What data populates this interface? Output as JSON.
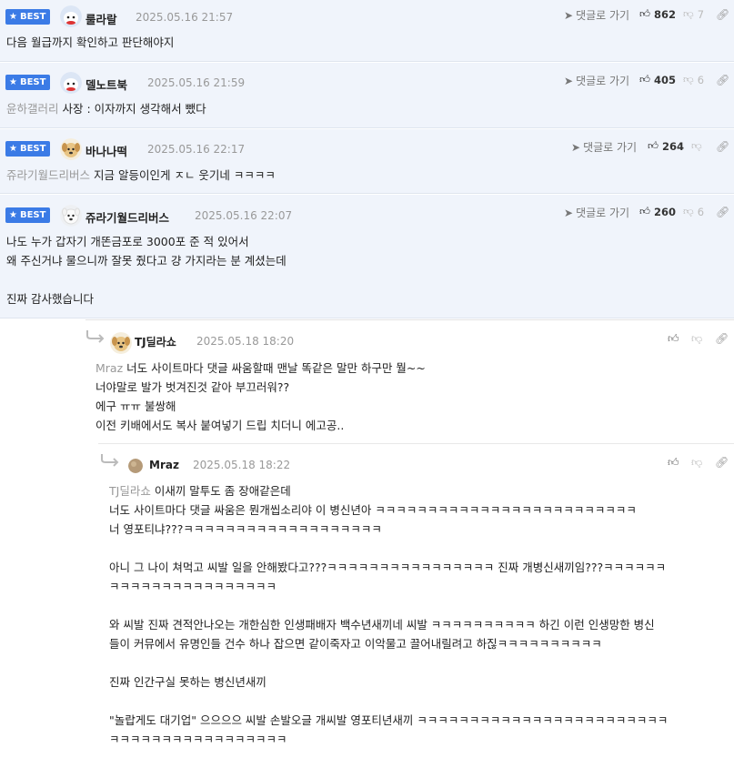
{
  "best_label": "BEST",
  "goto_label": "댓글로 가기",
  "comments": [
    {
      "nick": "룰라랄",
      "date": "2025.05.16 21:57",
      "up": "862",
      "down": "7",
      "lines": [
        "다음 월급까지 확인하고 판단해야지"
      ],
      "avatar": "rabbit-avatar"
    },
    {
      "nick": "델노트북",
      "date": "2025.05.16 21:59",
      "up": "405",
      "down": "6",
      "mention": "윤하갤러리",
      "lines": [
        "사장 : 이자까지 생각해서 뺐다"
      ],
      "avatar": "rabbit-avatar"
    },
    {
      "nick": "바나나떡",
      "date": "2025.05.16 22:17",
      "up": "264",
      "down": "",
      "mention": "쥬라기월드리버스",
      "lines": [
        "지금 알등이인게 ㅈㄴ 웃기네 ㅋㅋㅋㅋ"
      ],
      "avatar": "dog-avatar"
    },
    {
      "nick": "쥬라기월드리버스",
      "date": "2025.05.16 22:07",
      "up": "260",
      "down": "6",
      "lines": [
        "나도 누가 갑자기 개똔금포로 3000포 준 적 있어서",
        "왜 주신거냐 물으니까 잘못 줬다고 걍 가지라는 분 계셨는데",
        "",
        "진짜 감사했습니다"
      ],
      "avatar": "dog-white-avatar"
    }
  ],
  "reply1": {
    "nick": "TJ딜라쇼",
    "date": "2025.05.18 18:20",
    "mention": "Mraz",
    "lines": [
      "너도 사이트마다 댓글 싸움할때 맨날 똑같은 말만 하구만 뭘~~",
      "너야말로 발가 벗겨진것 같아 부끄러워??",
      "에구 ㅠㅠ 불쌍해",
      "이전 키배에서도 복사 붙여넣기 드립 치더니 에고공.."
    ]
  },
  "reply2": {
    "nick": "Mraz",
    "date": "2025.05.18 18:22",
    "mention": "TJ딜라쇼",
    "lines": [
      "이새끼 말투도 좀 장애같은데",
      "너도 사이트마다 댓글 싸움은 뭔개씹소리야 이 병신년아 ㅋㅋㅋㅋㅋㅋㅋㅋㅋㅋㅋㅋㅋㅋㅋㅋㅋㅋㅋㅋㅋㅋㅋㅋㅋ",
      "너 영포티냐???ㅋㅋㅋㅋㅋㅋㅋㅋㅋㅋㅋㅋㅋㅋㅋㅋㅋㅋㅋ",
      "",
      "아니 그 나이 쳐먹고 씨발 일을 안해봤다고???ㅋㅋㅋㅋㅋㅋㅋㅋㅋㅋㅋㅋㅋㅋㅋㅋ 진짜 개병신새끼임???ㅋㅋㅋㅋㅋㅋ",
      "ㅋㅋㅋㅋㅋㅋㅋㅋㅋㅋㅋㅋㅋㅋㅋㅋ",
      "",
      "와 씨발 진짜 견적안나오는 개한심한 인생패배자 백수년새끼네 씨발 ㅋㅋㅋㅋㅋㅋㅋㅋㅋㅋ 하긴 이런 인생망한 병신",
      "들이 커뮤에서 유명인들 건수 하나 잡으면 같이죽자고 이악물고 끌어내릴려고 하짆ㅋㅋㅋㅋㅋㅋㅋㅋㅋㅋ",
      "",
      "진짜 인간구실 못하는 병신년새끼",
      "",
      "\"놀랍게도 대기업\" 으으으으 씨발 손발오글 개씨발 영포티년새끼 ㅋㅋㅋㅋㅋㅋㅋㅋㅋㅋㅋㅋㅋㅋㅋㅋㅋㅋㅋㅋㅋㅋㅋㅋ",
      "ㅋㅋㅋㅋㅋㅋㅋㅋㅋㅋㅋㅋㅋㅋㅋㅋㅋ"
    ]
  },
  "colors": {
    "best_bg": "#f0f4fb",
    "badge": "#3b7be6",
    "muted": "#999999"
  }
}
